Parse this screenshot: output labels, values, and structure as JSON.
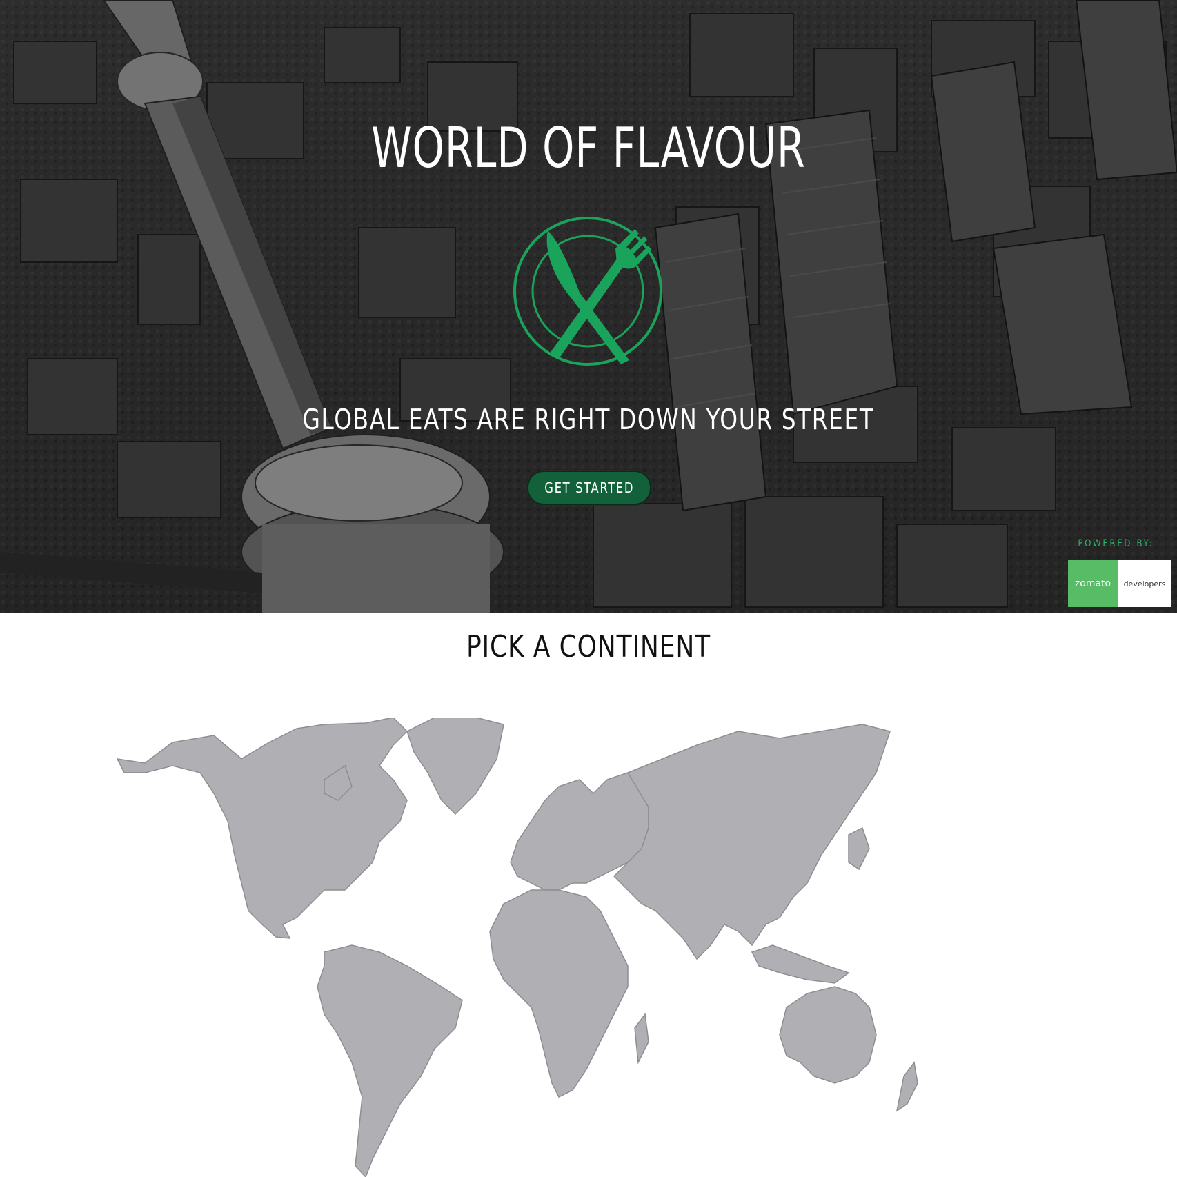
{
  "hero": {
    "title": "WORLD OF FLAVOUR",
    "tagline": "GLOBAL EATS ARE RIGHT DOWN YOUR STREET",
    "cta_label": "GET STARTED",
    "background_icon": "aerial-city-photo"
  },
  "attribution": {
    "powered_by": "POWERED BY:",
    "brand": "zomato",
    "brand_suffix": "developers"
  },
  "map_section": {
    "title": "PICK A CONTINENT",
    "continents": [
      "North America",
      "South America",
      "Europe",
      "Africa",
      "Asia",
      "Oceania"
    ]
  },
  "colors": {
    "accent": "#1aa35a",
    "button": "#12613a",
    "map_fill": "#b0afb3",
    "zomato_green": "#58bb66"
  }
}
